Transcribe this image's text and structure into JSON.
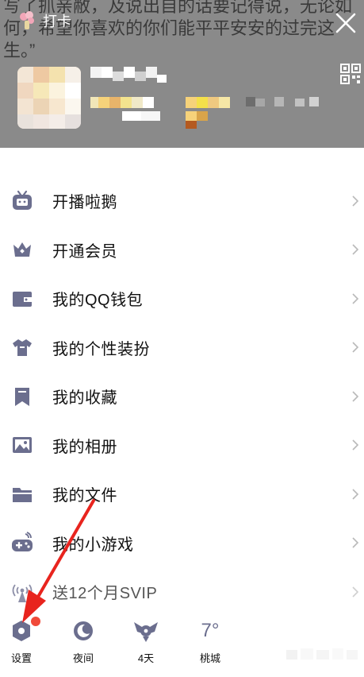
{
  "header": {
    "signature_text": "写了抓亲敝，及说出自的话要记得说，无论如\n何，希望你喜欢的你们能平平安安的过完这\n生。”",
    "checkin_label": "打卡",
    "colors": {
      "background": "#8a8a8a"
    }
  },
  "menu": {
    "items": [
      {
        "label": "开播啦鹅",
        "icon": "tv-icon"
      },
      {
        "label": "开通会员",
        "icon": "crown-icon"
      },
      {
        "label": "我的QQ钱包",
        "icon": "wallet-icon"
      },
      {
        "label": "我的个性装扮",
        "icon": "tshirt-icon"
      },
      {
        "label": "我的收藏",
        "icon": "bookmark-icon"
      },
      {
        "label": "我的相册",
        "icon": "photo-icon"
      },
      {
        "label": "我的文件",
        "icon": "folder-icon"
      },
      {
        "label": "我的小游戏",
        "icon": "gamepad-icon"
      },
      {
        "label": "送12个月SVIP",
        "icon": "broadcast-icon"
      }
    ]
  },
  "bottom_bar": {
    "settings_label": "设置",
    "night_label": "夜间",
    "days_label": "4天",
    "weather_temp": "7°",
    "city_label": "桃城"
  },
  "colors": {
    "icon": "#6b6e8e",
    "notification_dot": "#f04a3a",
    "annotation_arrow": "#e8241e"
  }
}
